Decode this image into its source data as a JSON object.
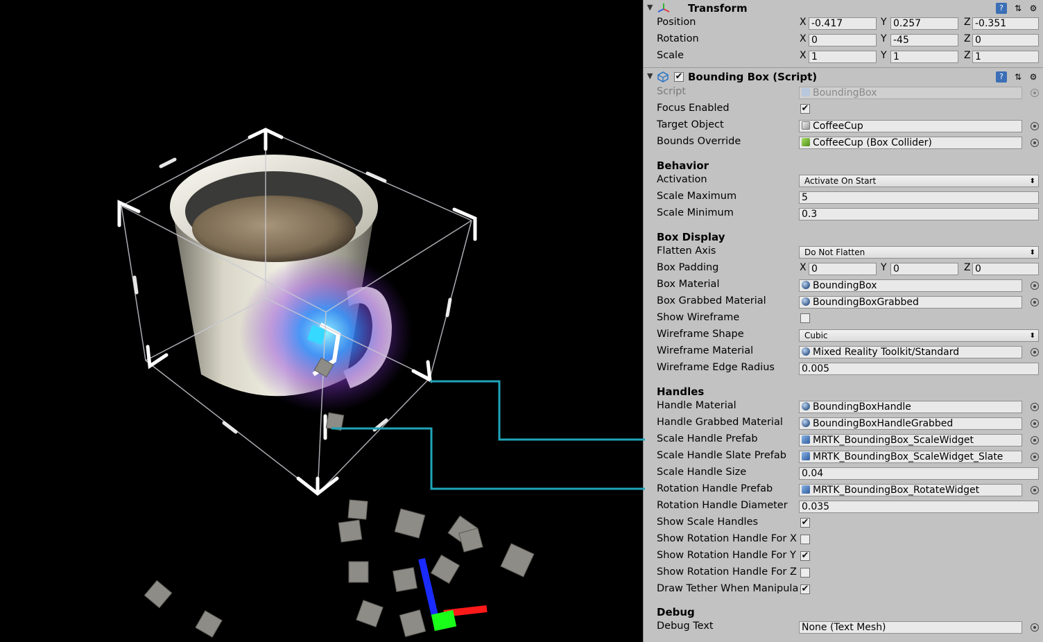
{
  "transform": {
    "title": "Transform",
    "rows": [
      {
        "label": "Position",
        "x": "-0.417",
        "y": "0.257",
        "z": "-0.351"
      },
      {
        "label": "Rotation",
        "x": "0",
        "y": "-45",
        "z": "0"
      },
      {
        "label": "Scale",
        "x": "1",
        "y": "1",
        "z": "1"
      }
    ],
    "axes": [
      "X",
      "Y",
      "Z"
    ]
  },
  "component": {
    "title": "Bounding Box (Script)",
    "enabled": true,
    "script_label": "Script",
    "script_value": "BoundingBox",
    "focus_enabled_label": "Focus Enabled",
    "focus_enabled": true,
    "target_object_label": "Target Object",
    "target_object_value": "CoffeeCup",
    "bounds_override_label": "Bounds Override",
    "bounds_override_value": "CoffeeCup (Box Collider)"
  },
  "behavior": {
    "heading": "Behavior",
    "activation_label": "Activation",
    "activation_value": "Activate On Start",
    "scale_max_label": "Scale Maximum",
    "scale_max_value": "5",
    "scale_min_label": "Scale Minimum",
    "scale_min_value": "0.3"
  },
  "box_display": {
    "heading": "Box Display",
    "flatten_label": "Flatten Axis",
    "flatten_value": "Do Not Flatten",
    "padding_label": "Box Padding",
    "padding_x": "0",
    "padding_y": "0",
    "padding_z": "0",
    "box_material_label": "Box Material",
    "box_material_value": "BoundingBox",
    "box_grabbed_label": "Box Grabbed Material",
    "box_grabbed_value": "BoundingBoxGrabbed",
    "show_wireframe_label": "Show Wireframe",
    "show_wireframe": false,
    "wire_shape_label": "Wireframe Shape",
    "wire_shape_value": "Cubic",
    "wire_material_label": "Wireframe Material",
    "wire_material_value": "Mixed Reality Toolkit/Standard",
    "wire_radius_label": "Wireframe Edge Radius",
    "wire_radius_value": "0.005"
  },
  "handles": {
    "heading": "Handles",
    "handle_material_label": "Handle Material",
    "handle_material_value": "BoundingBoxHandle",
    "handle_grabbed_label": "Handle Grabbed Material",
    "handle_grabbed_value": "BoundingBoxHandleGrabbed",
    "scale_prefab_label": "Scale Handle Prefab",
    "scale_prefab_value": "MRTK_BoundingBox_ScaleWidget",
    "scale_slate_label": "Scale Handle Slate Prefab",
    "scale_slate_value": "MRTK_BoundingBox_ScaleWidget_Slate",
    "scale_size_label": "Scale Handle Size",
    "scale_size_value": "0.04",
    "rot_prefab_label": "Rotation Handle Prefab",
    "rot_prefab_value": "MRTK_BoundingBox_RotateWidget",
    "rot_diameter_label": "Rotation Handle Diameter",
    "rot_diameter_value": "0.035",
    "show_scale_label": "Show Scale Handles",
    "show_scale": true,
    "show_rot_x_label": "Show Rotation Handle For X",
    "show_rot_x": false,
    "show_rot_y_label": "Show Rotation Handle For Y",
    "show_rot_y": true,
    "show_rot_z_label": "Show Rotation Handle For Z",
    "show_rot_z": false,
    "draw_tether_label": "Draw Tether When Manipulating",
    "draw_tether": true
  },
  "debug": {
    "heading": "Debug",
    "debug_text_label": "Debug Text",
    "debug_text_value": "None (Text Mesh)"
  },
  "colors": {
    "inspector_bg": "#c2c2c2",
    "callout_line": "#1fa5b8",
    "gizmo_x": "#ff1a1a",
    "gizmo_y": "#1aff1a",
    "gizmo_z": "#1a2bff"
  },
  "icons": {
    "header_buttons": [
      "help-icon",
      "preset-icon",
      "gear-icon"
    ],
    "checkmark": "✔"
  }
}
